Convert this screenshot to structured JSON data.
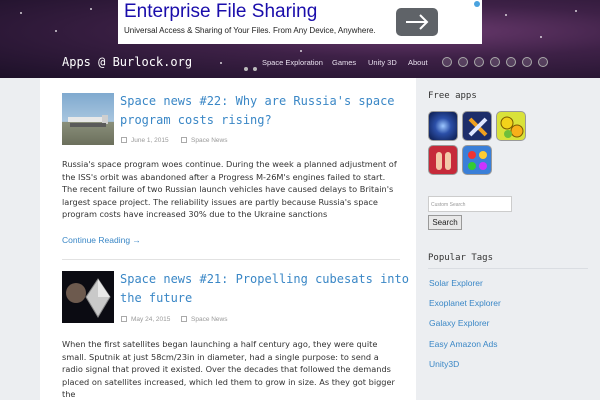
{
  "ad": {
    "title": "Enterprise File Sharing",
    "subtitle": "Universal Access & Sharing of Your Files. From Any Device, Anywhere."
  },
  "site": {
    "title": "Apps @ Burlock.org"
  },
  "nav": [
    "Space Exploration",
    "Games",
    "Unity 3D",
    "About"
  ],
  "posts": [
    {
      "title": "Space news #22: Why are Russia's space program costs rising?",
      "date": "June 1, 2015",
      "category": "Space News",
      "excerpt": "Russia's space program woes continue. During the week a planned adjustment of the ISS's orbit was abandoned after a Progress M-26M's engines failed to start. The recent failure of two Russian launch vehicles have caused delays to Britain's largest space project. The reliability issues are partly because Russia's space program costs have increased 30% due to the Ukraine sanctions",
      "continue": "Continue Reading →"
    },
    {
      "title": "Space news #21: Propelling cubesats into the future",
      "date": "May 24, 2015",
      "category": "Space News",
      "excerpt": "When the first satellites began launching a half century ago, they were quite small. Sputnik at just 58cm/23in in diameter, had a single purpose: to send a radio signal that proved it existed. Over the decades that followed the demands placed on satellites increased, which led them to grow in size. As they got bigger the"
    }
  ],
  "sidebar": {
    "free_apps_heading": "Free apps",
    "search_placeholder": "Custom Search",
    "search_button": "Search",
    "popular_tags_heading": "Popular Tags",
    "tags": [
      "Solar Explorer",
      "Exoplanet Explorer",
      "Galaxy Explorer",
      "Easy Amazon Ads",
      "Unity3D"
    ]
  },
  "colors": {
    "link": "#3a87c6",
    "header": "#3e2147"
  }
}
